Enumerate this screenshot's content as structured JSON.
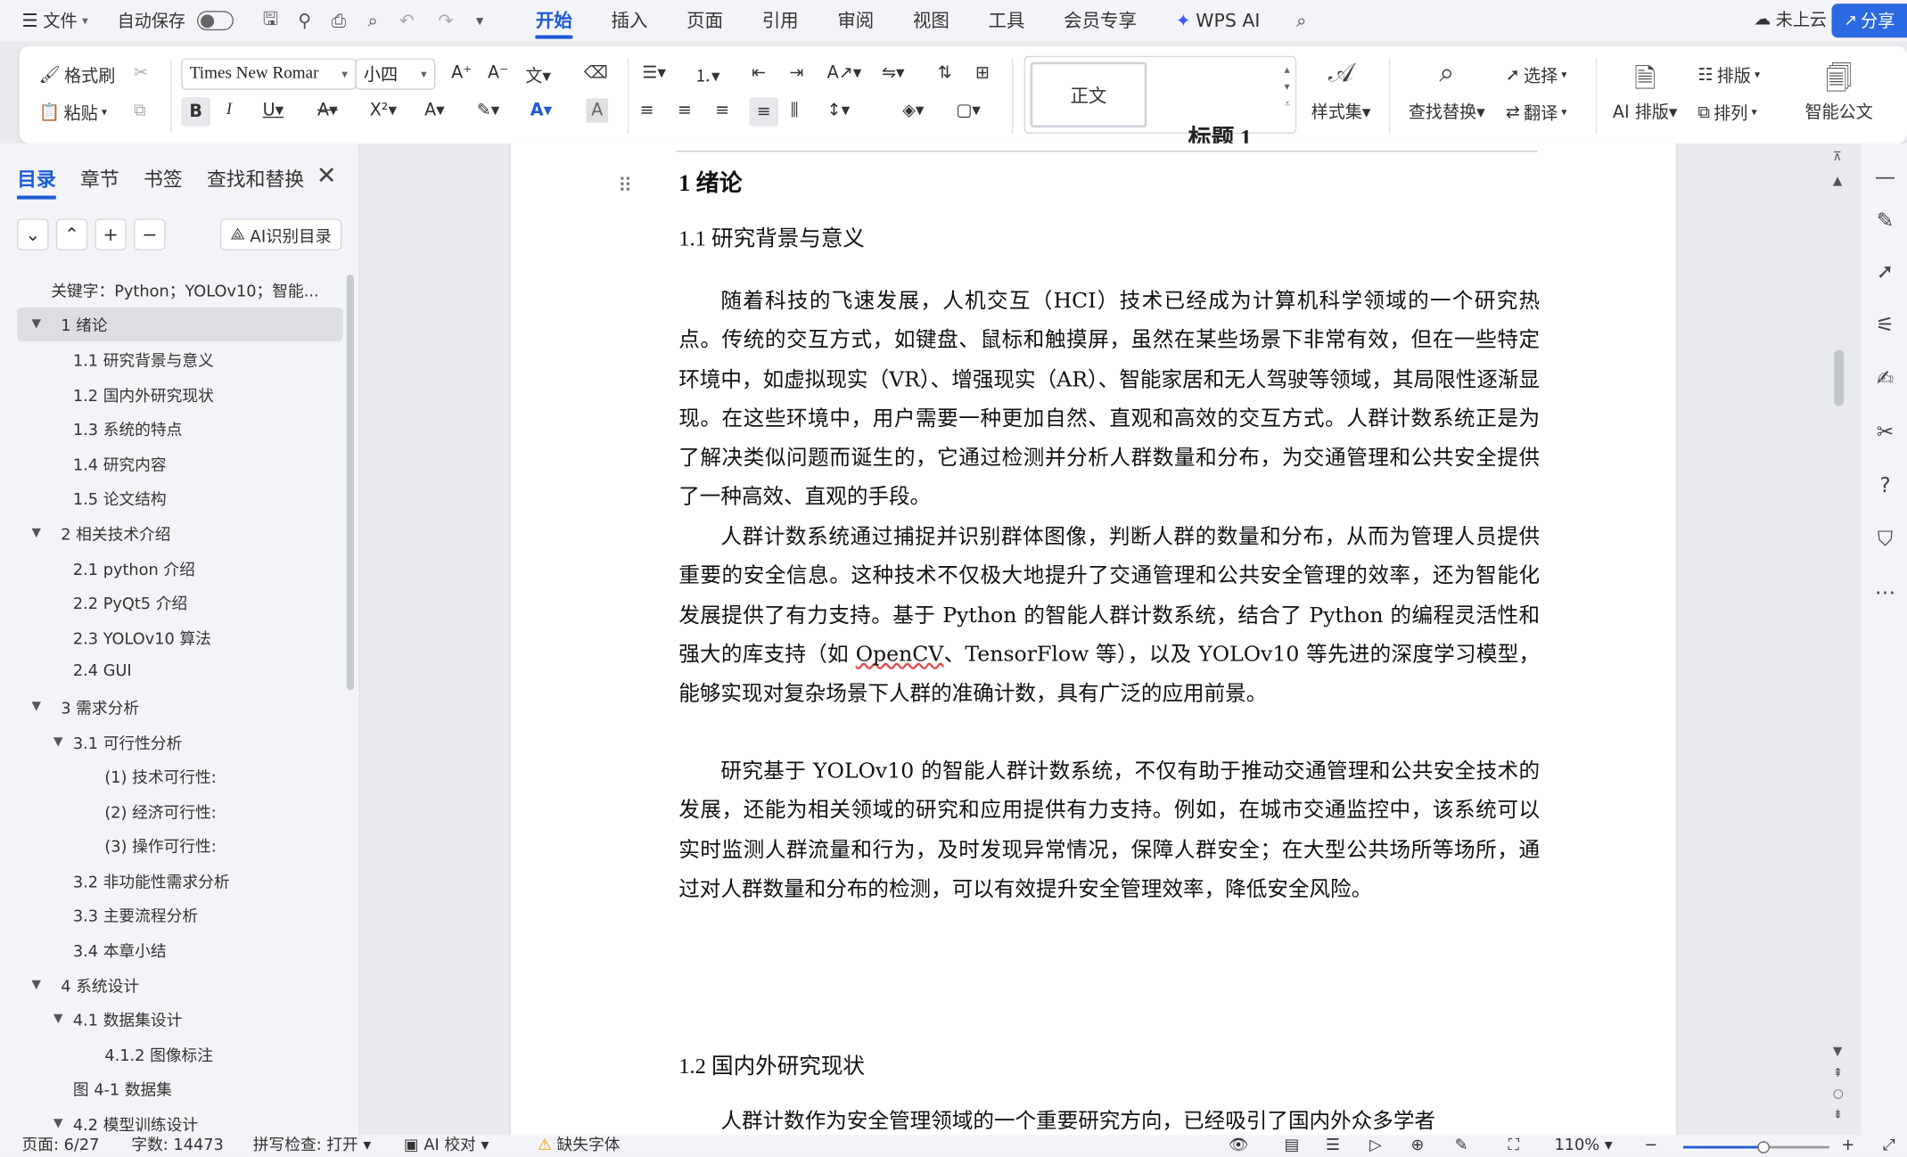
{
  "menubar": {
    "file_label": "文件",
    "autosave_label": "自动保存",
    "tabs": [
      "开始",
      "插入",
      "页面",
      "引用",
      "审阅",
      "视图",
      "工具",
      "会员专享",
      "WPS AI"
    ],
    "active_tab": "开始",
    "cloud_label": "未上云",
    "share_label": "分享"
  },
  "ribbon": {
    "format_painter": "格式刷",
    "paste": "粘贴",
    "font_name": "Times New Romar",
    "font_size": "小四",
    "style_normal": "正文",
    "style_heading1": "标题 1",
    "style_set": "样式集",
    "find_replace": "查找替换",
    "select": "选择",
    "translate": "翻译",
    "ai_layout": "AI 排版",
    "layout": "排版",
    "arrange": "排列",
    "smart_doc": "智能公文"
  },
  "nav": {
    "tabs": [
      "目录",
      "章节",
      "书签",
      "查找和替换"
    ],
    "active_tab": "目录",
    "ai_toc_label": "AI识别目录",
    "items": [
      {
        "label": "关键字：Python；YOLOv10；智能...",
        "level": 0,
        "caret": ""
      },
      {
        "label": "1  绪论",
        "level": 0,
        "caret": "▼",
        "selected": true
      },
      {
        "label": "1.1 研究背景与意义",
        "level": 1,
        "caret": ""
      },
      {
        "label": "1.2 国内外研究现状",
        "level": 1,
        "caret": ""
      },
      {
        "label": "1.3 系统的特点",
        "level": 1,
        "caret": ""
      },
      {
        "label": "1.4 研究内容",
        "level": 1,
        "caret": ""
      },
      {
        "label": "1.5 论文结构",
        "level": 1,
        "caret": ""
      },
      {
        "label": "2  相关技术介绍",
        "level": 0,
        "caret": "▼"
      },
      {
        "label": "2.1 python 介绍",
        "level": 1,
        "caret": ""
      },
      {
        "label": "2.2 PyQt5 介绍",
        "level": 1,
        "caret": ""
      },
      {
        "label": "2.3 YOLOv10 算法",
        "level": 1,
        "caret": ""
      },
      {
        "label": "2.4 GUI",
        "level": 1,
        "caret": ""
      },
      {
        "label": "3  需求分析",
        "level": 0,
        "caret": "▼"
      },
      {
        "label": "3.1 可行性分析",
        "level": 1,
        "caret": "▼"
      },
      {
        "label": "(1) 技术可行性:",
        "level": 2,
        "caret": ""
      },
      {
        "label": "(2) 经济可行性:",
        "level": 2,
        "caret": ""
      },
      {
        "label": "(3) 操作可行性:",
        "level": 2,
        "caret": ""
      },
      {
        "label": "3.2  非功能性需求分析",
        "level": 1,
        "caret": ""
      },
      {
        "label": "3.3 主要流程分析",
        "level": 1,
        "caret": ""
      },
      {
        "label": "3.4 本章小结",
        "level": 1,
        "caret": ""
      },
      {
        "label": "4  系统设计",
        "level": 0,
        "caret": "▼"
      },
      {
        "label": "4.1  数据集设计",
        "level": 1,
        "caret": "▼"
      },
      {
        "label": "4.1.2 图像标注",
        "level": 2,
        "caret": ""
      },
      {
        "label": "图 4-1  数据集",
        "level": 1,
        "caret": ""
      },
      {
        "label": "4.2  模型训练设计",
        "level": 1,
        "caret": "▼"
      }
    ]
  },
  "doc": {
    "h1": "1  绪论",
    "h2_a": "1.1 研究背景与意义",
    "p1": "随着科技的飞速发展，人机交互（HCI）技术已经成为计算机科学领域的一个研究热点。传统的交互方式，如键盘、鼠标和触摸屏，虽然在某些场景下非常有效，但在一些特定环境中，如虚拟现实（VR）、增强现实（AR）、智能家居和无人驾驶等领域，其局限性逐渐显现。在这些环境中，用户需要一种更加自然、直观和高效的交互方式。人群计数系统正是为了解决类似问题而诞生的，它通过检测并分析人群数量和分布，为交通管理和公共安全提供了一种高效、直观的手段。",
    "p2_a": "人群计数系统通过捕捉并识别群体图像，判断人群的数量和分布，从而为管理人员提供重要的安全信息。这种技术不仅极大地提升了交通管理和公共安全管理的效率，还为智能化发展提供了有力支持。基于 Python 的智能人群计数系统，结合了 Python 的编程灵活性和强大的库支持（如 ",
    "p2_wavy": "OpenCV",
    "p2_b": "、TensorFlow 等），以及 YOLOv10 等先进的深度学习模型，能够实现对复杂场景下人群的准确计数，具有广泛的应用前景。",
    "p3": "研究基于 YOLOv10 的智能人群计数系统，不仅有助于推动交通管理和公共安全技术的发展，还能为相关领域的研究和应用提供有力支持。例如，在城市交通监控中，该系统可以实时监测人群流量和行为，及时发现异常情况，保障人群安全；在大型公共场所等场所，通过对人群数量和分布的检测，可以有效提升安全管理效率，降低安全风险。",
    "h2_b": "1.2 国内外研究现状",
    "p4": "人群计数作为安全管理领域的一个重要研究方向，已经吸引了国内外众多学者"
  },
  "status": {
    "page": "页面: 6/27",
    "words": "字数: 14473",
    "spell": "拼写检查: 打开",
    "ai_check": "AI 校对",
    "missing_font": "缺失字体",
    "zoom": "110%",
    "zoom_level": 0.55
  },
  "colors": {
    "accent": "#1f5bd6",
    "share_bg": "#2c6ae3"
  }
}
